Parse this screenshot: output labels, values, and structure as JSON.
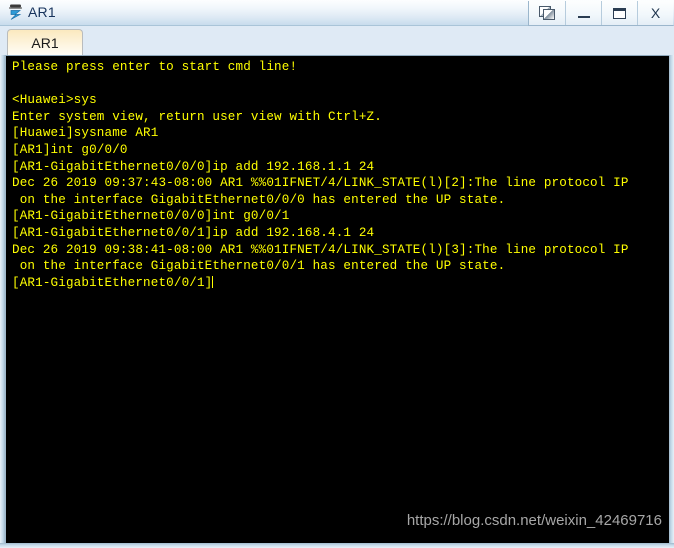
{
  "window": {
    "title": "AR1",
    "icon": "router-device-icon",
    "controls": [
      {
        "name": "restore-button",
        "icon": "restore-windows-icon",
        "label": ""
      },
      {
        "name": "minimize-button",
        "icon": "minimize-icon",
        "label": ""
      },
      {
        "name": "maximize-button",
        "icon": "maximize-icon",
        "label": ""
      },
      {
        "name": "close-button",
        "icon": "close-icon",
        "label": "X"
      }
    ]
  },
  "tabs": [
    {
      "label": "AR1",
      "active": true
    }
  ],
  "terminal": {
    "foreground_color": "#ffff00",
    "background_color": "#000000",
    "lines": [
      "Please press enter to start cmd line!",
      "",
      "<Huawei>sys",
      "Enter system view, return user view with Ctrl+Z.",
      "[Huawei]sysname AR1",
      "[AR1]int g0/0/0",
      "[AR1-GigabitEthernet0/0/0]ip add 192.168.1.1 24",
      "Dec 26 2019 09:37:43-08:00 AR1 %%01IFNET/4/LINK_STATE(l)[2]:The line protocol IP",
      " on the interface GigabitEthernet0/0/0 has entered the UP state.",
      "[AR1-GigabitEthernet0/0/0]int g0/0/1",
      "[AR1-GigabitEthernet0/0/1]ip add 192.168.4.1 24",
      "Dec 26 2019 09:38:41-08:00 AR1 %%01IFNET/4/LINK_STATE(l)[3]:The line protocol IP",
      " on the interface GigabitEthernet0/0/1 has entered the UP state.",
      "[AR1-GigabitEthernet0/0/1]"
    ],
    "prompt_line_index": 13
  },
  "watermark": {
    "text": "https://blog.csdn.net/weixin_42469716",
    "color": "#a7a7a7"
  }
}
